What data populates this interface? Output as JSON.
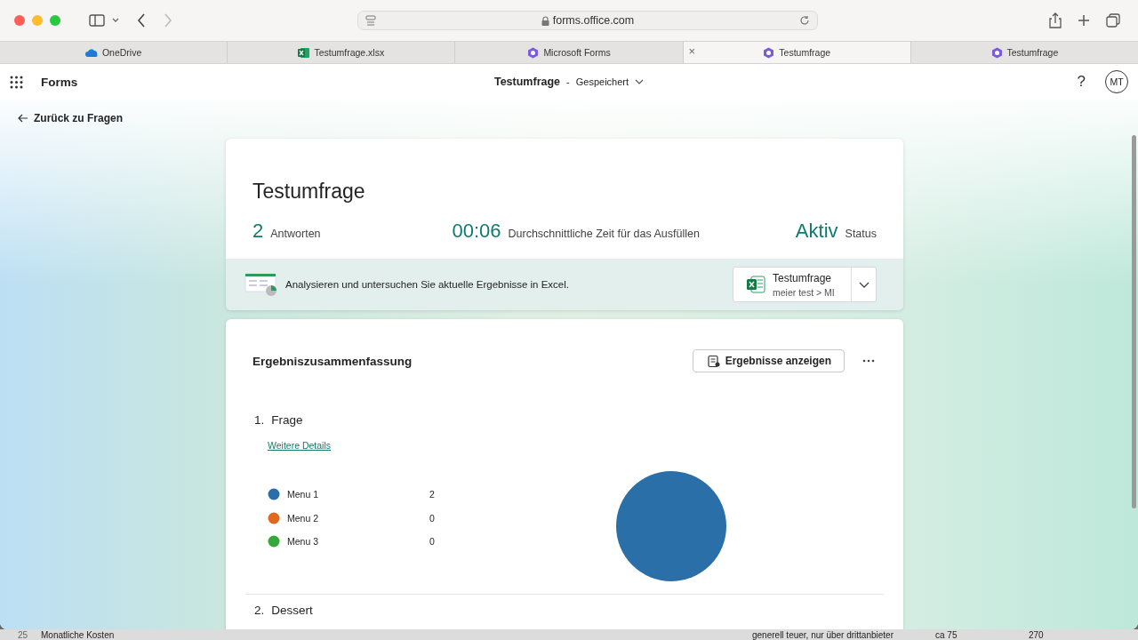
{
  "browser": {
    "address": "forms.office.com",
    "tabs": [
      {
        "label": "OneDrive",
        "kind": "cloud",
        "selected": false
      },
      {
        "label": "Testumfrage.xlsx",
        "kind": "sheet",
        "selected": false
      },
      {
        "label": "Microsoft Forms",
        "kind": "form",
        "selected": false
      },
      {
        "label": "Testumfrage",
        "kind": "form",
        "selected": true,
        "close": "×"
      },
      {
        "label": "Testumfrage",
        "kind": "form",
        "selected": false
      }
    ]
  },
  "app": {
    "name": "Forms",
    "document_title": "Testumfrage",
    "separator": "-",
    "save_status": "Gespeichert",
    "help": "?",
    "avatar": "MT"
  },
  "back_link": "Zurück zu Fragen",
  "summary": {
    "title": "Testumfrage",
    "stats": [
      {
        "value": "2",
        "label": "Antworten"
      },
      {
        "value": "00:06",
        "label": "Durchschnittliche Zeit für das Ausfüllen"
      },
      {
        "value": "Aktiv",
        "label": "Status"
      }
    ]
  },
  "excel_banner": {
    "text": "Analysieren und untersuchen Sie aktuelle Ergebnisse in Excel.",
    "workbook": "Testumfrage",
    "path": "meier test > MI"
  },
  "results": {
    "title": "Ergebniszusammenfassung",
    "view_button": "Ergebnisse anzeigen",
    "questions": [
      {
        "number": "1.",
        "title": "Frage",
        "details_link": "Weitere Details",
        "legend": [
          {
            "color": "#2a6fa8",
            "count": "2"
          },
          {
            "color": "#e0691f",
            "count": "0"
          },
          {
            "color": "#36a83b",
            "count": "0"
          }
        ],
        "chart_data": {
          "type": "pie",
          "categories": [
            "Menu 1",
            "Menu 2",
            "Menu 3"
          ],
          "series": [
            {
              "values": [
                100,
                0,
                0
              ]
            }
          ]
        }
      },
      {
        "number": "2.",
        "title": "Dessert"
      }
    ]
  },
  "background_sheet": {
    "row": [
      "25",
      "Monatliche Kosten",
      "generell teuer, nur über drittanbieter",
      "ca 75",
      "270"
    ]
  }
}
